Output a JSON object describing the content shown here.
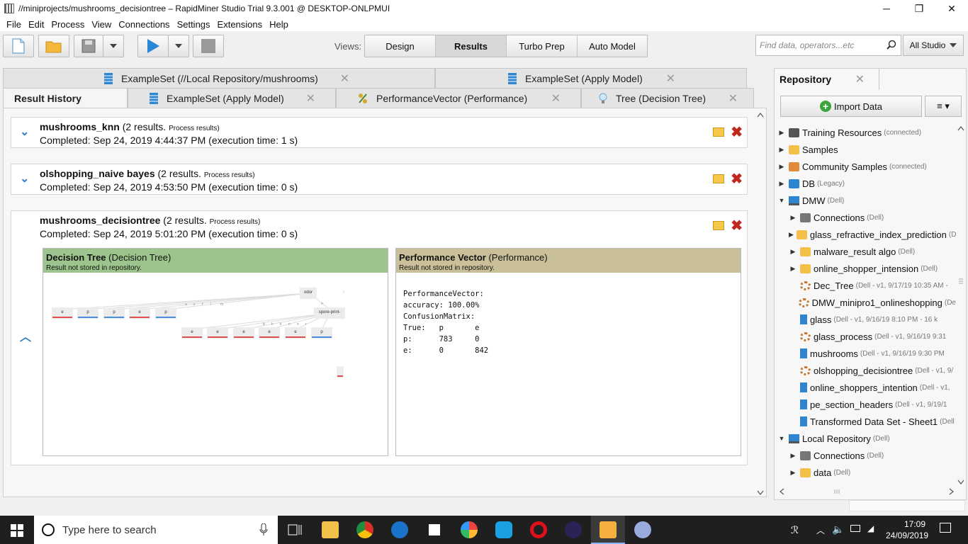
{
  "window": {
    "title": "//miniprojects/mushrooms_decisiontree – RapidMiner Studio Trial 9.3.001 @ DESKTOP-ONLPMUI",
    "minimize": "─",
    "maximize": "❐",
    "close": "✕"
  },
  "menu": [
    "File",
    "Edit",
    "Process",
    "View",
    "Connections",
    "Settings",
    "Extensions",
    "Help"
  ],
  "toolbar": {
    "views_label": "Views:",
    "views": [
      "Design",
      "Results",
      "Turbo Prep",
      "Auto Model"
    ],
    "active_view": "Results",
    "search_placeholder": "Find data, operators...etc",
    "scope": "All Studio"
  },
  "tabs_row1": [
    {
      "label": "ExampleSet (//Local Repository/mushrooms)",
      "icon": "table-icon"
    },
    {
      "label": "ExampleSet (Apply Model)",
      "icon": "table-icon"
    }
  ],
  "tabs_row2": [
    {
      "label": "Result History",
      "active": true
    },
    {
      "label": "ExampleSet (Apply Model)",
      "icon": "table-icon"
    },
    {
      "label": "PerformanceVector (Performance)",
      "icon": "percent-icon"
    },
    {
      "label": "Tree (Decision Tree)",
      "icon": "bulb-icon"
    }
  ],
  "results": [
    {
      "name": "mushrooms_knn",
      "count": "(2 results.",
      "link": "Process results)",
      "completed": "Completed: Sep 24, 2019 4:44:37 PM (execution time: 1 s)"
    },
    {
      "name": "olshopping_naive bayes",
      "count": "(2 results.",
      "link": "Process results)",
      "completed": "Completed: Sep 24, 2019 4:53:50 PM (execution time: 0 s)"
    },
    {
      "name": "mushrooms_decisiontree",
      "count": "(2 results.",
      "link": "Process results)",
      "completed": "Completed: Sep 24, 2019 5:01:20 PM (execution time: 0 s)"
    }
  ],
  "cards": {
    "tree": {
      "title": "Decision Tree",
      "subtitle": "(Decision Tree)",
      "note": "Result not stored in repository."
    },
    "perf": {
      "title": "Performance Vector",
      "subtitle": "(Performance)",
      "note": "Result not stored in repository."
    }
  },
  "tree_viz": {
    "root": "odor",
    "child": "spore-print-",
    "root_edges": [
      "a",
      "c",
      "f",
      "l",
      "m",
      "n"
    ],
    "child_edges": [
      "b",
      "h",
      "k",
      "n",
      "o",
      "r"
    ],
    "top_leaves": [
      "e",
      "p",
      "p",
      "e",
      "p"
    ],
    "bottom_leaves": [
      "e",
      "e",
      "e",
      "e",
      "e",
      "p"
    ]
  },
  "performance": {
    "header": "PerformanceVector:",
    "accuracy": "accuracy: 100.00%",
    "matrix_title": "ConfusionMatrix:",
    "matrix_header": "True:   p       e",
    "row_p": "p:      783     0",
    "row_e": "e:      0       842"
  },
  "repository": {
    "title": "Repository",
    "import_label": "Import Data",
    "menu_icon": "≡ ▾",
    "items": [
      {
        "label": "Training Resources",
        "meta": "(connected)",
        "level": 0,
        "arrow": "▶",
        "icon": "graduation-icon"
      },
      {
        "label": "Samples",
        "meta": "",
        "level": 0,
        "arrow": "▶",
        "icon": "folder-icon"
      },
      {
        "label": "Community Samples",
        "meta": "(connected)",
        "level": 0,
        "arrow": "▶",
        "icon": "people-icon"
      },
      {
        "label": "DB",
        "meta": "(Legacy)",
        "level": 0,
        "arrow": "▶",
        "icon": "database-icon"
      },
      {
        "label": "DMW",
        "meta": "(Dell)",
        "level": 0,
        "arrow": "▼",
        "icon": "monitor-icon"
      },
      {
        "label": "Connections",
        "meta": "(Dell)",
        "level": 1,
        "arrow": "▶",
        "icon": "plug-icon"
      },
      {
        "label": "glass_refractive_index_prediction",
        "meta": "(D",
        "level": 1,
        "arrow": "▶",
        "icon": "folder-icon"
      },
      {
        "label": "malware_result algo",
        "meta": "(Dell)",
        "level": 1,
        "arrow": "▶",
        "icon": "folder-icon"
      },
      {
        "label": "online_shopper_intension",
        "meta": "(Dell)",
        "level": 1,
        "arrow": "▶",
        "icon": "folder-icon"
      },
      {
        "label": "Dec_Tree",
        "meta": "(Dell - v1, 9/17/19 10:35 AM -",
        "level": 1,
        "arrow": "",
        "icon": "process-icon"
      },
      {
        "label": "DMW_minipro1_onlineshopping",
        "meta": "(De",
        "level": 1,
        "arrow": "",
        "icon": "process-icon"
      },
      {
        "label": "glass",
        "meta": "(Dell - v1, 9/16/19 8:10 PM - 16 k",
        "level": 1,
        "arrow": "",
        "icon": "data-icon"
      },
      {
        "label": "glass_process",
        "meta": "(Dell - v1, 9/16/19 9:31",
        "level": 1,
        "arrow": "",
        "icon": "process-icon"
      },
      {
        "label": "mushrooms",
        "meta": "(Dell - v1, 9/16/19 9:30 PM",
        "level": 1,
        "arrow": "",
        "icon": "data-icon"
      },
      {
        "label": "olshopping_decisiontree",
        "meta": "(Dell - v1, 9/",
        "level": 1,
        "arrow": "",
        "icon": "process-icon"
      },
      {
        "label": "online_shoppers_intention",
        "meta": "(Dell - v1,",
        "level": 1,
        "arrow": "",
        "icon": "data-icon"
      },
      {
        "label": "pe_section_headers",
        "meta": "(Dell - v1, 9/19/1",
        "level": 1,
        "arrow": "",
        "icon": "data-icon"
      },
      {
        "label": "Transformed Data Set - Sheet1",
        "meta": "(Dell",
        "level": 1,
        "arrow": "",
        "icon": "data-icon"
      },
      {
        "label": "Local Repository",
        "meta": "(Dell)",
        "level": 0,
        "arrow": "▼",
        "icon": "monitor-icon"
      },
      {
        "label": "Connections",
        "meta": "(Dell)",
        "level": 1,
        "arrow": "▶",
        "icon": "plug-icon"
      },
      {
        "label": "data",
        "meta": "(Dell)",
        "level": 1,
        "arrow": "▶",
        "icon": "folder-icon"
      }
    ]
  },
  "taskbar": {
    "search_placeholder": "Type here to search",
    "time": "17:09",
    "date": "24/09/2019"
  },
  "colors": {
    "tree_header": "#9cc48c",
    "perf_header": "#c9c09a",
    "accent_blue": "#2a7fc7",
    "delete_red": "#c0281e",
    "leaf_red": "#e05050",
    "leaf_blue": "#4a8ee0"
  }
}
